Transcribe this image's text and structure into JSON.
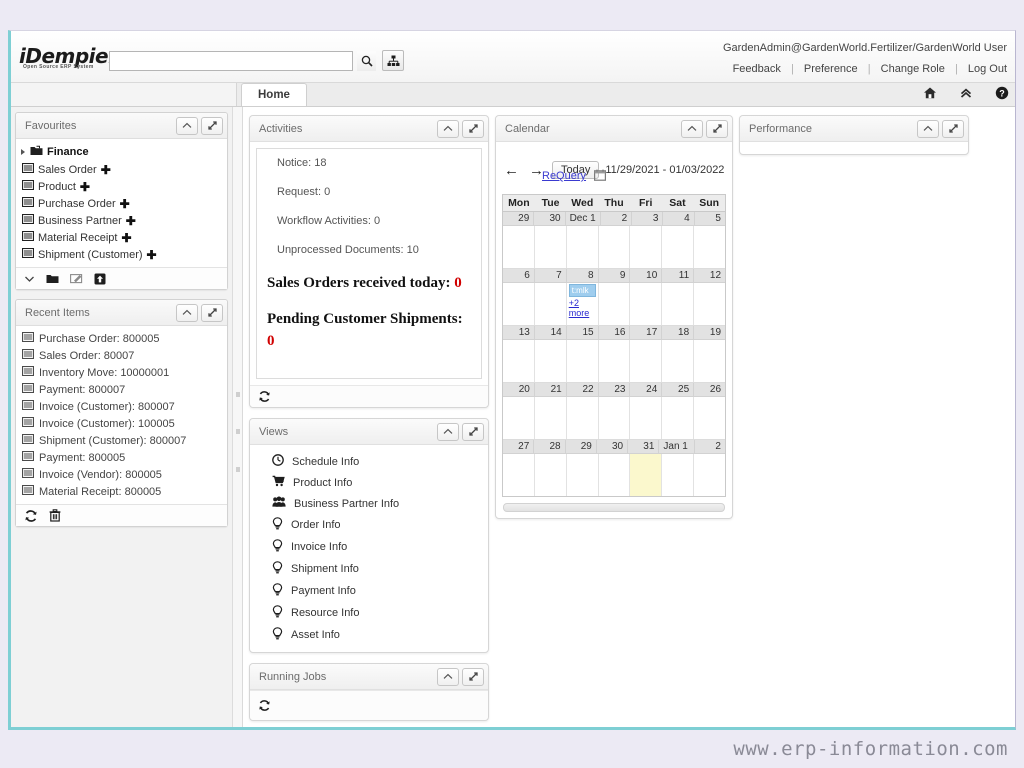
{
  "app": {
    "brand": "iDempiere",
    "brand_tagline": "Open Source ERP System",
    "accent_color": "#7ecfd4",
    "page_background": "#eceaf4"
  },
  "header": {
    "search_value": "",
    "search_placeholder": "",
    "search_icon": "search-icon",
    "menu_tree_icon": "sitemap-icon",
    "user_context": "GardenAdmin@GardenWorld.Fertilizer/GardenWorld User",
    "links": [
      "Feedback",
      "Preference",
      "Change Role",
      "Log Out"
    ]
  },
  "tabs": {
    "items": [
      {
        "label": "Home",
        "active": true
      }
    ],
    "icons": [
      "home-icon",
      "collapse-all-icon",
      "help-icon"
    ]
  },
  "sidebar": {
    "favourites": {
      "title": "Favourites",
      "collapse_label": "collapse",
      "expand_label": "maximize",
      "items": [
        {
          "label": "Finance",
          "type": "folder",
          "icon": "folder-icon",
          "plus": false
        },
        {
          "label": "Sales Order",
          "type": "window",
          "icon": "window-icon",
          "plus": true
        },
        {
          "label": "Product",
          "type": "window",
          "icon": "window-icon",
          "plus": true
        },
        {
          "label": "Purchase Order",
          "type": "window",
          "icon": "window-icon",
          "plus": true
        },
        {
          "label": "Business Partner",
          "type": "window",
          "icon": "window-icon",
          "plus": true
        },
        {
          "label": "Material Receipt",
          "type": "window",
          "icon": "window-icon",
          "plus": true
        },
        {
          "label": "Shipment (Customer)",
          "type": "window",
          "icon": "window-icon",
          "plus": true
        }
      ],
      "footer_icons": [
        "chevron-down-icon",
        "new-folder-icon",
        "rename-icon",
        "add-favourite-icon"
      ]
    },
    "recent_items": {
      "title": "Recent Items",
      "items": [
        "Purchase Order: 800005",
        "Sales Order: 80007",
        "Inventory Move: 10000001",
        "Payment: 800007",
        "Invoice (Customer): 800007",
        "Invoice (Customer): 100005",
        "Shipment (Customer): 800007",
        "Payment: 800005",
        "Invoice (Vendor): 800005",
        "Material Receipt: 800005"
      ],
      "footer_icons": [
        "refresh-icon",
        "trash-icon"
      ]
    }
  },
  "activities": {
    "title": "Activities",
    "lines": [
      "Notice: 18",
      "Request: 0",
      "Workflow Activities: 0",
      "Unprocessed Documents: 10"
    ],
    "headline_1_text": "Sales Orders received today:",
    "headline_1_value": "0",
    "headline_2_text": "Pending Customer Shipments: ",
    "headline_2_value": "0",
    "value_color": "#d00000",
    "refresh_icon": "refresh-icon"
  },
  "views": {
    "title": "Views",
    "items": [
      {
        "label": "Schedule Info",
        "icon": "clock-icon"
      },
      {
        "label": "Product Info",
        "icon": "cart-icon"
      },
      {
        "label": "Business Partner Info",
        "icon": "people-icon"
      },
      {
        "label": "Order Info",
        "icon": "bulb-icon"
      },
      {
        "label": "Invoice Info",
        "icon": "bulb-icon"
      },
      {
        "label": "Shipment Info",
        "icon": "bulb-icon"
      },
      {
        "label": "Payment Info",
        "icon": "bulb-icon"
      },
      {
        "label": "Resource Info",
        "icon": "bulb-icon"
      },
      {
        "label": "Asset Info",
        "icon": "bulb-icon"
      }
    ]
  },
  "running_jobs": {
    "title": "Running Jobs",
    "refresh_icon": "refresh-icon"
  },
  "performance": {
    "title": "Performance"
  },
  "calendar": {
    "title": "Calendar",
    "prev_label": "←",
    "next_label": "→",
    "today_label": "Today",
    "range": "11/29/2021 - 01/03/2022",
    "requery_label": "ReQuery",
    "datepicker_icon": "calendar-icon",
    "weekdays": [
      "Mon",
      "Tue",
      "Wed",
      "Thu",
      "Fri",
      "Sat",
      "Sun"
    ],
    "weeks": [
      {
        "days": [
          {
            "num": "29"
          },
          {
            "num": "30"
          },
          {
            "num": "Dec 1",
            "month_start": true
          },
          {
            "num": "2"
          },
          {
            "num": "3"
          },
          {
            "num": "4"
          },
          {
            "num": "5"
          }
        ]
      },
      {
        "days": [
          {
            "num": "6"
          },
          {
            "num": "7"
          },
          {
            "num": "8",
            "event": "t:mlk",
            "more": "+2 more"
          },
          {
            "num": "9"
          },
          {
            "num": "10"
          },
          {
            "num": "11"
          },
          {
            "num": "12"
          }
        ]
      },
      {
        "days": [
          {
            "num": "13"
          },
          {
            "num": "14"
          },
          {
            "num": "15"
          },
          {
            "num": "16"
          },
          {
            "num": "17"
          },
          {
            "num": "18"
          },
          {
            "num": "19"
          }
        ]
      },
      {
        "days": [
          {
            "num": "20"
          },
          {
            "num": "21"
          },
          {
            "num": "22"
          },
          {
            "num": "23"
          },
          {
            "num": "24"
          },
          {
            "num": "25"
          },
          {
            "num": "26"
          }
        ]
      },
      {
        "days": [
          {
            "num": "27"
          },
          {
            "num": "28"
          },
          {
            "num": "29"
          },
          {
            "num": "30"
          },
          {
            "num": "31",
            "today": true
          },
          {
            "num": "Jan 1",
            "month_start": true
          },
          {
            "num": "2"
          }
        ]
      }
    ]
  },
  "watermark": "www.erp-information.com"
}
